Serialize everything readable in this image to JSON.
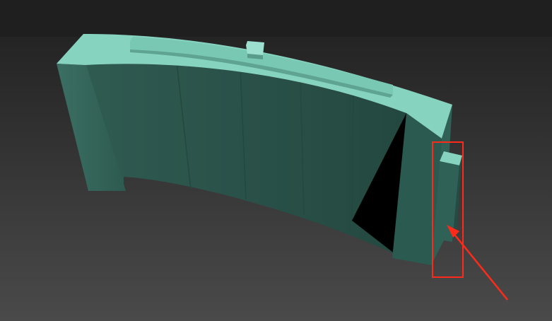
{
  "viewport": {
    "background_top": "#1f1f1f",
    "background_bottom": "#4a4a4a"
  },
  "model": {
    "top_face_color": "#86d3c0",
    "side_face_color": "#2f5b51",
    "inner_face_color": "#2a5149",
    "shadow_opening_color": "#000000"
  },
  "annotation": {
    "box_color": "#ff2a1a",
    "arrow_color": "#ff2a1a"
  }
}
